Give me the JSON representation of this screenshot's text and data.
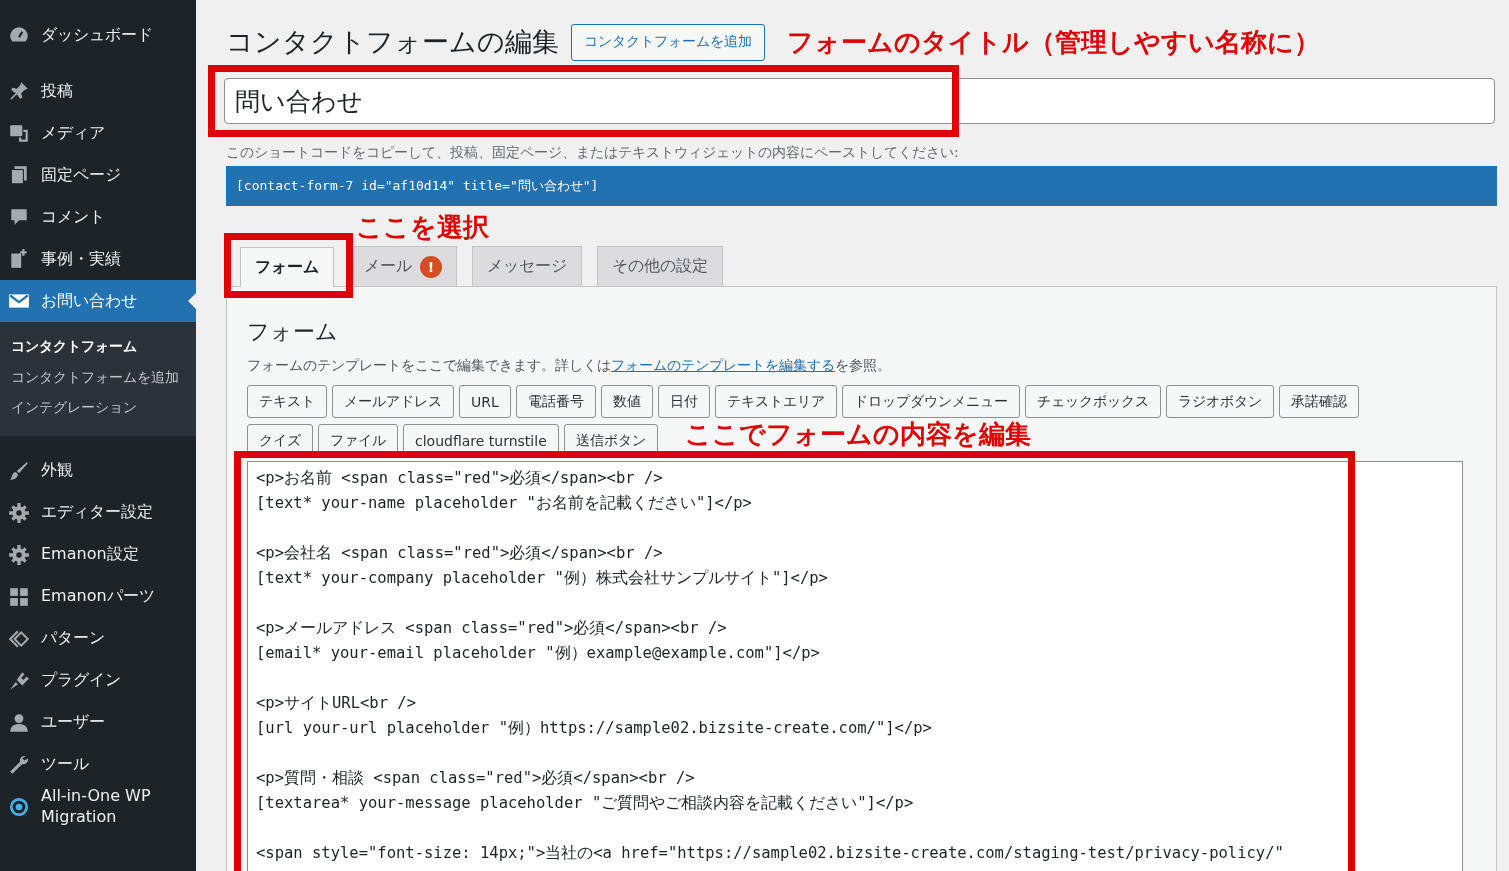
{
  "sidebar": {
    "items": [
      {
        "label": "ダッシュボード",
        "selected": false
      },
      {
        "label": "投稿",
        "selected": false
      },
      {
        "label": "メディア",
        "selected": false
      },
      {
        "label": "固定ページ",
        "selected": false
      },
      {
        "label": "コメント",
        "selected": false
      },
      {
        "label": "事例・実績",
        "selected": false
      },
      {
        "label": "お問い合わせ",
        "selected": true,
        "children": [
          {
            "label": "コンタクトフォーム",
            "selected": true
          },
          {
            "label": "コンタクトフォームを追加",
            "selected": false
          },
          {
            "label": "インテグレーション",
            "selected": false
          }
        ]
      },
      {
        "label": "外観",
        "selected": false
      },
      {
        "label": "エディター設定",
        "selected": false
      },
      {
        "label": "Emanon設定",
        "selected": false
      },
      {
        "label": "Emanonパーツ",
        "selected": false
      },
      {
        "label": "パターン",
        "selected": false
      },
      {
        "label": "プラグイン",
        "selected": false
      },
      {
        "label": "ユーザー",
        "selected": false
      },
      {
        "label": "ツール",
        "selected": false
      },
      {
        "label": "All-in-One WP Migration",
        "selected": false
      }
    ]
  },
  "header": {
    "title": "コンタクトフォームの編集",
    "add_button": "コンタクトフォームを追加"
  },
  "title_field": {
    "value": "問い合わせ"
  },
  "shortcode": {
    "label": "このショートコードをコピーして、投稿、固定ページ、またはテキストウィジェットの内容にペーストしてください:",
    "code": "[contact-form-7 id=\"af10d14\" title=\"問い合わせ\"]"
  },
  "tabs": [
    {
      "label": "フォーム",
      "selected": true
    },
    {
      "label": "メール",
      "selected": false,
      "alert": "!"
    },
    {
      "label": "メッセージ",
      "selected": false
    },
    {
      "label": "その他の設定",
      "selected": false
    }
  ],
  "panel": {
    "heading": "フォーム",
    "description": "フォームのテンプレートをここで編集できます。詳しくは",
    "link": "フォームのテンプレートを編集する",
    "description_end": "を参照。",
    "tag_buttons": [
      [
        "テキスト",
        "メールアドレス",
        "URL",
        "電話番号",
        "数値",
        "日付",
        "テキストエリア",
        "ドロップダウンメニュー",
        "チェックボックス",
        "ラジオボタン",
        "承諾確認"
      ],
      [
        "クイズ",
        "ファイル",
        "cloudflare turnstile",
        "送信ボタン"
      ]
    ],
    "editor": {
      "value": "<p>お名前 <span class=\"red\">必須</span><br />\n[text* your-name placeholder \"お名前を記載ください\"]</p>\n\n<p>会社名 <span class=\"red\">必須</span><br />\n[text* your-company placeholder \"例）株式会社サンプルサイト\"]</p>\n\n<p>メールアドレス <span class=\"red\">必須</span><br />\n[email* your-email placeholder \"例）example@example.com\"]</p>\n\n<p>サイトURL<br />\n[url your-url placeholder \"例）https://sample02.bizsite-create.com/\"]</p>\n\n<p>質問・相談 <span class=\"red\">必須</span><br />\n[textarea* your-message placeholder \"ご質問やご相談内容を記載ください\"]</p>\n\n<span style=\"font-size: 14px;\">当社の<a href=\"https://sample02.bizsite-create.com/staging-test/privacy-policy/\""
    }
  },
  "annotations": [
    {
      "kind": "title",
      "text": "フォームのタイトル（管理しやすい名称に）"
    },
    {
      "kind": "tab",
      "text": "ここを選択"
    },
    {
      "kind": "editor",
      "text": "ここでフォームの内容を編集"
    }
  ]
}
